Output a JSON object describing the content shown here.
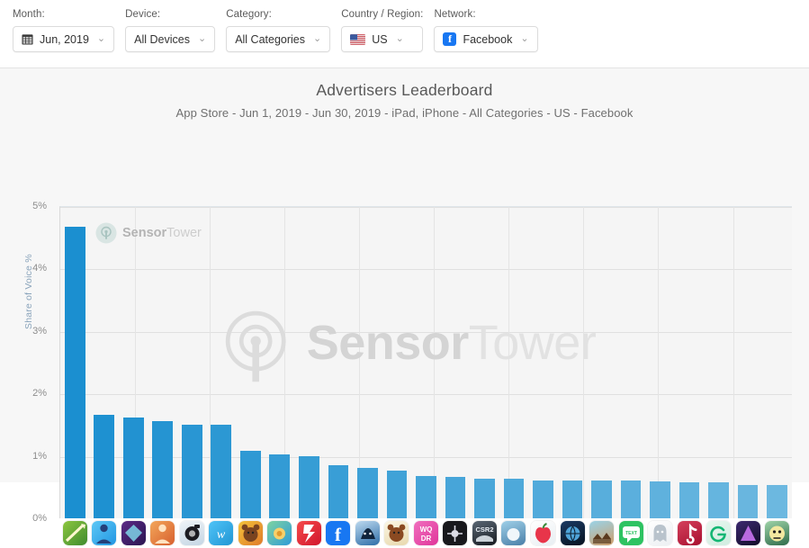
{
  "toolbar": {
    "filters": [
      {
        "label": "Month:",
        "value": "Jun, 2019",
        "icon": "calendar-icon",
        "name": "month"
      },
      {
        "label": "Device:",
        "value": "All Devices",
        "icon": "",
        "name": "device"
      },
      {
        "label": "Category:",
        "value": "All Categories",
        "icon": "",
        "name": "category"
      },
      {
        "label": "Country / Region:",
        "value": "US",
        "icon": "us-flag-icon",
        "name": "country"
      },
      {
        "label": "Network:",
        "value": "Facebook",
        "icon": "facebook-icon",
        "name": "network"
      }
    ],
    "caret": "⌄"
  },
  "watermark": {
    "bold": "Sensor",
    "light": "Tower"
  },
  "chart_data": {
    "type": "bar",
    "title": "Advertisers Leaderboard",
    "subtitle": "App Store - Jun 1, 2019 - Jun 30, 2019 - iPad, iPhone - All Categories - US - Facebook",
    "xlabel": "",
    "ylabel": "Share of Voice %",
    "ylim": [
      0,
      5
    ],
    "ytick_labels": [
      "0%",
      "1%",
      "2%",
      "3%",
      "4%",
      "5%"
    ],
    "ytick_values": [
      0,
      1,
      2,
      3,
      4,
      5
    ],
    "grid": true,
    "legend": "none",
    "bar_color_start": "#1b8fd0",
    "bar_color_end": "#6cb8e0",
    "categories": [
      "archery-game-icon",
      "business-tycoon-icon",
      "dark-fantasy-game-icon",
      "adventure-character-icon",
      "camera-app-icon",
      "wish-shopping-icon",
      "bear-game-icon",
      "farm-game-icon",
      "messenger-icon",
      "facebook-icon",
      "wolf-game-icon",
      "beige-animal-game-icon",
      "word-puzzle-icon",
      "black-action-game-icon",
      "csr2-racing-icon",
      "golf-game-icon",
      "fruit-app-icon",
      "globe-game-icon",
      "village-game-icon",
      "textnow-icon",
      "ghost-app-icon",
      "music-note-app-icon",
      "green-g-app-icon",
      "prism-app-icon",
      "zombie-game-icon"
    ],
    "values": [
      4.67,
      1.66,
      1.61,
      1.56,
      1.5,
      1.5,
      1.08,
      1.02,
      0.99,
      0.85,
      0.8,
      0.76,
      0.68,
      0.67,
      0.63,
      0.63,
      0.61,
      0.61,
      0.6,
      0.6,
      0.59,
      0.57,
      0.57,
      0.54,
      0.53
    ]
  }
}
